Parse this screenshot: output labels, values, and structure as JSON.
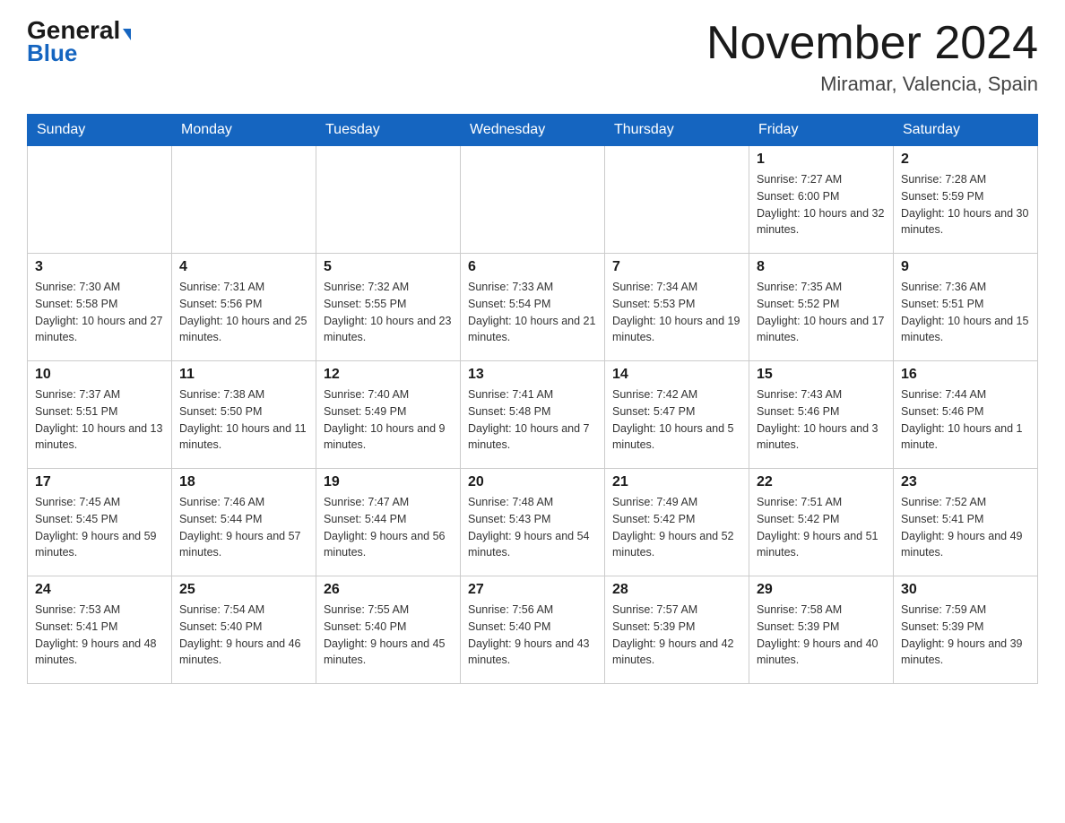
{
  "header": {
    "logo": {
      "general": "General",
      "blue": "Blue"
    },
    "title": "November 2024",
    "location": "Miramar, Valencia, Spain"
  },
  "weekdays": [
    "Sunday",
    "Monday",
    "Tuesday",
    "Wednesday",
    "Thursday",
    "Friday",
    "Saturday"
  ],
  "weeks": [
    [
      {
        "day": "",
        "info": ""
      },
      {
        "day": "",
        "info": ""
      },
      {
        "day": "",
        "info": ""
      },
      {
        "day": "",
        "info": ""
      },
      {
        "day": "",
        "info": ""
      },
      {
        "day": "1",
        "info": "Sunrise: 7:27 AM\nSunset: 6:00 PM\nDaylight: 10 hours and 32 minutes."
      },
      {
        "day": "2",
        "info": "Sunrise: 7:28 AM\nSunset: 5:59 PM\nDaylight: 10 hours and 30 minutes."
      }
    ],
    [
      {
        "day": "3",
        "info": "Sunrise: 7:30 AM\nSunset: 5:58 PM\nDaylight: 10 hours and 27 minutes."
      },
      {
        "day": "4",
        "info": "Sunrise: 7:31 AM\nSunset: 5:56 PM\nDaylight: 10 hours and 25 minutes."
      },
      {
        "day": "5",
        "info": "Sunrise: 7:32 AM\nSunset: 5:55 PM\nDaylight: 10 hours and 23 minutes."
      },
      {
        "day": "6",
        "info": "Sunrise: 7:33 AM\nSunset: 5:54 PM\nDaylight: 10 hours and 21 minutes."
      },
      {
        "day": "7",
        "info": "Sunrise: 7:34 AM\nSunset: 5:53 PM\nDaylight: 10 hours and 19 minutes."
      },
      {
        "day": "8",
        "info": "Sunrise: 7:35 AM\nSunset: 5:52 PM\nDaylight: 10 hours and 17 minutes."
      },
      {
        "day": "9",
        "info": "Sunrise: 7:36 AM\nSunset: 5:51 PM\nDaylight: 10 hours and 15 minutes."
      }
    ],
    [
      {
        "day": "10",
        "info": "Sunrise: 7:37 AM\nSunset: 5:51 PM\nDaylight: 10 hours and 13 minutes."
      },
      {
        "day": "11",
        "info": "Sunrise: 7:38 AM\nSunset: 5:50 PM\nDaylight: 10 hours and 11 minutes."
      },
      {
        "day": "12",
        "info": "Sunrise: 7:40 AM\nSunset: 5:49 PM\nDaylight: 10 hours and 9 minutes."
      },
      {
        "day": "13",
        "info": "Sunrise: 7:41 AM\nSunset: 5:48 PM\nDaylight: 10 hours and 7 minutes."
      },
      {
        "day": "14",
        "info": "Sunrise: 7:42 AM\nSunset: 5:47 PM\nDaylight: 10 hours and 5 minutes."
      },
      {
        "day": "15",
        "info": "Sunrise: 7:43 AM\nSunset: 5:46 PM\nDaylight: 10 hours and 3 minutes."
      },
      {
        "day": "16",
        "info": "Sunrise: 7:44 AM\nSunset: 5:46 PM\nDaylight: 10 hours and 1 minute."
      }
    ],
    [
      {
        "day": "17",
        "info": "Sunrise: 7:45 AM\nSunset: 5:45 PM\nDaylight: 9 hours and 59 minutes."
      },
      {
        "day": "18",
        "info": "Sunrise: 7:46 AM\nSunset: 5:44 PM\nDaylight: 9 hours and 57 minutes."
      },
      {
        "day": "19",
        "info": "Sunrise: 7:47 AM\nSunset: 5:44 PM\nDaylight: 9 hours and 56 minutes."
      },
      {
        "day": "20",
        "info": "Sunrise: 7:48 AM\nSunset: 5:43 PM\nDaylight: 9 hours and 54 minutes."
      },
      {
        "day": "21",
        "info": "Sunrise: 7:49 AM\nSunset: 5:42 PM\nDaylight: 9 hours and 52 minutes."
      },
      {
        "day": "22",
        "info": "Sunrise: 7:51 AM\nSunset: 5:42 PM\nDaylight: 9 hours and 51 minutes."
      },
      {
        "day": "23",
        "info": "Sunrise: 7:52 AM\nSunset: 5:41 PM\nDaylight: 9 hours and 49 minutes."
      }
    ],
    [
      {
        "day": "24",
        "info": "Sunrise: 7:53 AM\nSunset: 5:41 PM\nDaylight: 9 hours and 48 minutes."
      },
      {
        "day": "25",
        "info": "Sunrise: 7:54 AM\nSunset: 5:40 PM\nDaylight: 9 hours and 46 minutes."
      },
      {
        "day": "26",
        "info": "Sunrise: 7:55 AM\nSunset: 5:40 PM\nDaylight: 9 hours and 45 minutes."
      },
      {
        "day": "27",
        "info": "Sunrise: 7:56 AM\nSunset: 5:40 PM\nDaylight: 9 hours and 43 minutes."
      },
      {
        "day": "28",
        "info": "Sunrise: 7:57 AM\nSunset: 5:39 PM\nDaylight: 9 hours and 42 minutes."
      },
      {
        "day": "29",
        "info": "Sunrise: 7:58 AM\nSunset: 5:39 PM\nDaylight: 9 hours and 40 minutes."
      },
      {
        "day": "30",
        "info": "Sunrise: 7:59 AM\nSunset: 5:39 PM\nDaylight: 9 hours and 39 minutes."
      }
    ]
  ]
}
